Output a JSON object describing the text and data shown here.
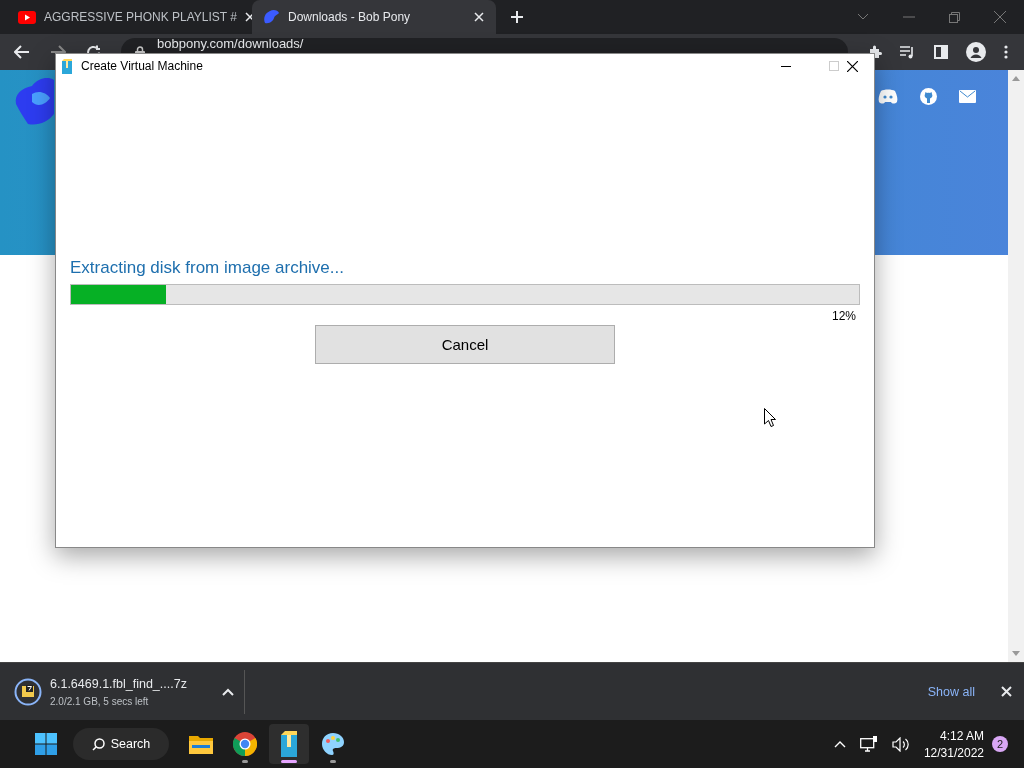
{
  "browser": {
    "tabs": [
      {
        "title": "AGGRESSIVE PHONK PLAYLIST #",
        "kind": "video",
        "selected": false
      },
      {
        "title": "Downloads - Bob Pony",
        "kind": "site",
        "selected": true
      }
    ],
    "address": "bobpony.com/downloads/"
  },
  "dialog": {
    "title": "Create Virtual Machine",
    "status": "Extracting disk from image archive...",
    "progress": {
      "level": 0.12,
      "reading": "12%"
    },
    "button": "Cancel"
  },
  "download": {
    "filename": "6.1.6469.1.fbl_find_....7z",
    "detail": "2.0/2.1 GB, 5 secs left",
    "show_all": "Show all"
  },
  "taskbar": {
    "search": "Search",
    "apps": [
      {
        "kind": "folder",
        "running": false,
        "selected": false
      },
      {
        "kind": "browser",
        "running": true,
        "selected": false
      },
      {
        "kind": "archive",
        "running": true,
        "selected": true
      },
      {
        "kind": "paint",
        "running": true,
        "selected": false
      }
    ],
    "time": "4:12 AM",
    "date": "12/31/2022",
    "badge": "2"
  }
}
